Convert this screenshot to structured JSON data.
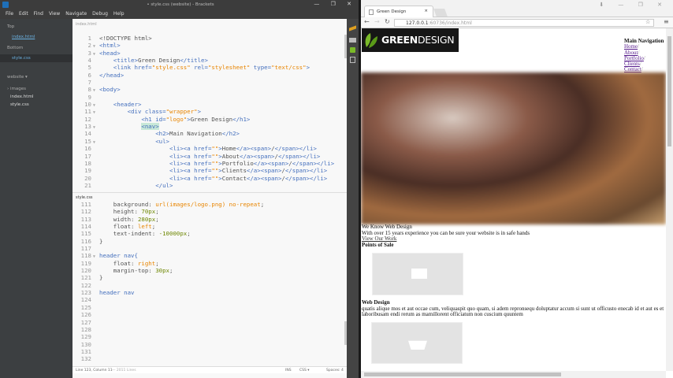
{
  "editor": {
    "title": "• style.css (website) - Brackets",
    "window_controls": "— ❐ ✕",
    "menu": [
      "File",
      "Edit",
      "Find",
      "View",
      "Navigate",
      "Debug",
      "Help"
    ],
    "sidebar": {
      "working_top": "Top",
      "top_files": [
        "index.html"
      ],
      "working_bottom": "Bottom",
      "bottom_files": [
        "style.css"
      ],
      "project": "website ▾",
      "tree": [
        "› images",
        "index.html",
        "style.css"
      ]
    },
    "top_pane_label": "index.html",
    "bottom_pane_label": "style.css",
    "top_code": [
      {
        "n": "1",
        "f": "",
        "s": [
          [
            "<!DOCTYPE html>",
            "t-prop"
          ]
        ]
      },
      {
        "n": "2",
        "f": "▼",
        "s": [
          [
            "<html>",
            "t-tag"
          ]
        ]
      },
      {
        "n": "3",
        "f": "▼",
        "s": [
          [
            "<head>",
            "t-tag"
          ]
        ]
      },
      {
        "n": "4",
        "f": "",
        "s": [
          [
            "    <title>",
            "t-tag"
          ],
          [
            "Green Design",
            ""
          ],
          [
            "</title>",
            "t-tag"
          ]
        ]
      },
      {
        "n": "5",
        "f": "",
        "s": [
          [
            "    <link ",
            "t-tag"
          ],
          [
            "href=",
            "t-attr"
          ],
          [
            "\"style.css\"",
            "t-str"
          ],
          [
            " rel=",
            "t-attr"
          ],
          [
            "\"stylesheet\"",
            "t-str"
          ],
          [
            " type=",
            "t-attr"
          ],
          [
            "\"text/css\"",
            "t-str"
          ],
          [
            ">",
            "t-tag"
          ]
        ]
      },
      {
        "n": "6",
        "f": "",
        "s": [
          [
            "</head>",
            "t-tag"
          ]
        ]
      },
      {
        "n": "7",
        "f": "",
        "s": [
          [
            "",
            ""
          ]
        ]
      },
      {
        "n": "8",
        "f": "▼",
        "s": [
          [
            "<body>",
            "t-tag"
          ]
        ]
      },
      {
        "n": "9",
        "f": "",
        "s": [
          [
            "",
            ""
          ]
        ]
      },
      {
        "n": "10",
        "f": "▼",
        "s": [
          [
            "    <header>",
            "t-tag"
          ]
        ]
      },
      {
        "n": "11",
        "f": "▼",
        "s": [
          [
            "        <div ",
            "t-tag"
          ],
          [
            "class=",
            "t-attr"
          ],
          [
            "\"wrapper\"",
            "t-str"
          ],
          [
            ">",
            "t-tag"
          ]
        ]
      },
      {
        "n": "12",
        "f": "",
        "s": [
          [
            "            <h1 ",
            "t-tag"
          ],
          [
            "id=",
            "t-attr"
          ],
          [
            "\"logo\"",
            "t-str"
          ],
          [
            ">",
            "t-tag"
          ],
          [
            "Green Design",
            ""
          ],
          [
            "</h1>",
            "t-tag"
          ]
        ]
      },
      {
        "n": "13",
        "f": "▼",
        "s": [
          [
            "            ",
            ""
          ],
          [
            "<nav>",
            "t-tag t-hl"
          ]
        ]
      },
      {
        "n": "14",
        "f": "",
        "s": [
          [
            "                <h2>",
            "t-tag"
          ],
          [
            "Main Navigation",
            ""
          ],
          [
            "</h2>",
            "t-tag"
          ]
        ]
      },
      {
        "n": "15",
        "f": "▼",
        "s": [
          [
            "                <ul>",
            "t-tag"
          ]
        ]
      },
      {
        "n": "16",
        "f": "",
        "s": [
          [
            "                    <li><a ",
            "t-tag"
          ],
          [
            "href=",
            "t-attr"
          ],
          [
            "\"\"",
            "t-str"
          ],
          [
            ">",
            "t-tag"
          ],
          [
            "Home",
            ""
          ],
          [
            "</a><span>",
            "t-tag"
          ],
          [
            "/",
            ""
          ],
          [
            "</span></li>",
            "t-tag"
          ]
        ]
      },
      {
        "n": "17",
        "f": "",
        "s": [
          [
            "                    <li><a ",
            "t-tag"
          ],
          [
            "href=",
            "t-attr"
          ],
          [
            "\"\"",
            "t-str"
          ],
          [
            ">",
            "t-tag"
          ],
          [
            "About",
            ""
          ],
          [
            "</a><span>",
            "t-tag"
          ],
          [
            "/",
            ""
          ],
          [
            "</span></li>",
            "t-tag"
          ]
        ]
      },
      {
        "n": "18",
        "f": "",
        "s": [
          [
            "                    <li><a ",
            "t-tag"
          ],
          [
            "href=",
            "t-attr"
          ],
          [
            "\"\"",
            "t-str"
          ],
          [
            ">",
            "t-tag"
          ],
          [
            "Portfolio",
            ""
          ],
          [
            "</a><span>",
            "t-tag"
          ],
          [
            "/",
            ""
          ],
          [
            "</span></li>",
            "t-tag"
          ]
        ]
      },
      {
        "n": "19",
        "f": "",
        "s": [
          [
            "                    <li><a ",
            "t-tag"
          ],
          [
            "href=",
            "t-attr"
          ],
          [
            "\"\"",
            "t-str"
          ],
          [
            ">",
            "t-tag"
          ],
          [
            "Clients",
            ""
          ],
          [
            "</a><span>",
            "t-tag"
          ],
          [
            "/",
            ""
          ],
          [
            "</span></li>",
            "t-tag"
          ]
        ]
      },
      {
        "n": "20",
        "f": "",
        "s": [
          [
            "                    <li><a ",
            "t-tag"
          ],
          [
            "href=",
            "t-attr"
          ],
          [
            "\"\"",
            "t-str"
          ],
          [
            ">",
            "t-tag"
          ],
          [
            "Contact",
            ""
          ],
          [
            "</a><span>",
            "t-tag"
          ],
          [
            "/",
            ""
          ],
          [
            "</span></li>",
            "t-tag"
          ]
        ]
      },
      {
        "n": "21",
        "f": "",
        "s": [
          [
            "                </ul>",
            "t-tag"
          ]
        ]
      }
    ],
    "bottom_code": [
      {
        "n": "111",
        "f": "",
        "s": [
          [
            "    background: ",
            "t-prop"
          ],
          [
            "url(images/logo.png) no-repeat",
            "t-val"
          ],
          [
            ";",
            ""
          ]
        ]
      },
      {
        "n": "112",
        "f": "",
        "s": [
          [
            "    height: ",
            "t-prop"
          ],
          [
            "70px",
            "t-num"
          ],
          [
            ";",
            ""
          ]
        ]
      },
      {
        "n": "113",
        "f": "",
        "s": [
          [
            "    width: ",
            "t-prop"
          ],
          [
            "280px",
            "t-num"
          ],
          [
            ";",
            ""
          ]
        ]
      },
      {
        "n": "114",
        "f": "",
        "s": [
          [
            "    float: ",
            "t-prop"
          ],
          [
            "left",
            "t-val"
          ],
          [
            ";",
            ""
          ]
        ]
      },
      {
        "n": "115",
        "f": "",
        "s": [
          [
            "    text-indent: ",
            "t-prop"
          ],
          [
            "-10000px",
            "t-num"
          ],
          [
            ";",
            ""
          ]
        ]
      },
      {
        "n": "116",
        "f": "",
        "s": [
          [
            "}",
            ""
          ]
        ]
      },
      {
        "n": "117",
        "f": "",
        "s": [
          [
            "",
            ""
          ]
        ]
      },
      {
        "n": "118",
        "f": "▼",
        "s": [
          [
            "header nav{",
            "t-tag"
          ]
        ]
      },
      {
        "n": "119",
        "f": "",
        "s": [
          [
            "    float: ",
            "t-prop"
          ],
          [
            "right",
            "t-val"
          ],
          [
            ";",
            ""
          ]
        ]
      },
      {
        "n": "120",
        "f": "",
        "s": [
          [
            "    margin-top: ",
            "t-prop"
          ],
          [
            "30px",
            "t-num"
          ],
          [
            ";",
            ""
          ]
        ]
      },
      {
        "n": "121",
        "f": "",
        "s": [
          [
            "}",
            ""
          ]
        ]
      },
      {
        "n": "122",
        "f": "",
        "s": [
          [
            "",
            ""
          ]
        ]
      },
      {
        "n": "123",
        "f": "",
        "s": [
          [
            "header nav",
            "t-tag"
          ]
        ]
      },
      {
        "n": "124",
        "f": "",
        "s": [
          [
            "",
            ""
          ]
        ]
      },
      {
        "n": "125",
        "f": "",
        "s": [
          [
            "",
            ""
          ]
        ]
      },
      {
        "n": "126",
        "f": "",
        "s": [
          [
            "",
            ""
          ]
        ]
      },
      {
        "n": "127",
        "f": "",
        "s": [
          [
            "",
            ""
          ]
        ]
      },
      {
        "n": "128",
        "f": "",
        "s": [
          [
            "",
            ""
          ]
        ]
      },
      {
        "n": "129",
        "f": "",
        "s": [
          [
            "",
            ""
          ]
        ]
      },
      {
        "n": "130",
        "f": "",
        "s": [
          [
            "",
            ""
          ]
        ]
      },
      {
        "n": "131",
        "f": "",
        "s": [
          [
            "",
            ""
          ]
        ]
      },
      {
        "n": "132",
        "f": "",
        "s": [
          [
            "",
            ""
          ]
        ]
      }
    ],
    "status": {
      "position": "Line 123, Column 11",
      "lines": "— 2011 Lines",
      "mode": "INS",
      "language": "CSS ▾",
      "spaces": "Spaces: 4"
    }
  },
  "browser": {
    "tab_title": "Green Design",
    "tab_close": "×",
    "window_controls": "⬇ — ❐ ✕",
    "url_host": "127.0.0.1",
    "url_rest": ":60736/index.html",
    "page": {
      "logo_bold": "GREEN",
      "logo_light": "DESIGN",
      "nav_heading": "Main Navigation",
      "nav_items": [
        "Home",
        "About",
        "Portfolio",
        "Clients",
        "Contact"
      ],
      "nav_sep": "/",
      "intro_heading": "We Know Web Design",
      "intro_text": "With over 15 years experience you can be sure your website is in safe hands",
      "intro_link": "View Our Work",
      "pos_heading": "Points of Sale",
      "web_heading": "Web Design",
      "web_text": "quatis alique mos et aut occae cum, veliquaspit quo quam, si adem repronsequ doluptatur accum si sunt ut officusto enecab id et aut es et laboribusam endi rerum as mamillorent officiatum non cuscium quuntem"
    }
  },
  "colors": {
    "accent": "#7aba28",
    "tag": "#446fbd",
    "string": "#e88501"
  }
}
